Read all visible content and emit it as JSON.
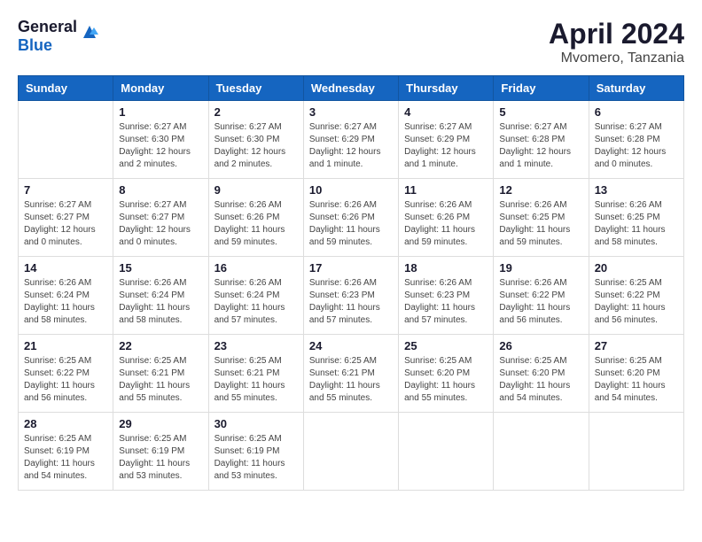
{
  "header": {
    "logo_general": "General",
    "logo_blue": "Blue",
    "month_year": "April 2024",
    "location": "Mvomero, Tanzania"
  },
  "columns": [
    "Sunday",
    "Monday",
    "Tuesday",
    "Wednesday",
    "Thursday",
    "Friday",
    "Saturday"
  ],
  "weeks": [
    [
      {
        "day": "",
        "sunrise": "",
        "sunset": "",
        "daylight": ""
      },
      {
        "day": "1",
        "sunrise": "Sunrise: 6:27 AM",
        "sunset": "Sunset: 6:30 PM",
        "daylight": "Daylight: 12 hours and 2 minutes."
      },
      {
        "day": "2",
        "sunrise": "Sunrise: 6:27 AM",
        "sunset": "Sunset: 6:30 PM",
        "daylight": "Daylight: 12 hours and 2 minutes."
      },
      {
        "day": "3",
        "sunrise": "Sunrise: 6:27 AM",
        "sunset": "Sunset: 6:29 PM",
        "daylight": "Daylight: 12 hours and 1 minute."
      },
      {
        "day": "4",
        "sunrise": "Sunrise: 6:27 AM",
        "sunset": "Sunset: 6:29 PM",
        "daylight": "Daylight: 12 hours and 1 minute."
      },
      {
        "day": "5",
        "sunrise": "Sunrise: 6:27 AM",
        "sunset": "Sunset: 6:28 PM",
        "daylight": "Daylight: 12 hours and 1 minute."
      },
      {
        "day": "6",
        "sunrise": "Sunrise: 6:27 AM",
        "sunset": "Sunset: 6:28 PM",
        "daylight": "Daylight: 12 hours and 0 minutes."
      }
    ],
    [
      {
        "day": "7",
        "sunrise": "Sunrise: 6:27 AM",
        "sunset": "Sunset: 6:27 PM",
        "daylight": "Daylight: 12 hours and 0 minutes."
      },
      {
        "day": "8",
        "sunrise": "Sunrise: 6:27 AM",
        "sunset": "Sunset: 6:27 PM",
        "daylight": "Daylight: 12 hours and 0 minutes."
      },
      {
        "day": "9",
        "sunrise": "Sunrise: 6:26 AM",
        "sunset": "Sunset: 6:26 PM",
        "daylight": "Daylight: 11 hours and 59 minutes."
      },
      {
        "day": "10",
        "sunrise": "Sunrise: 6:26 AM",
        "sunset": "Sunset: 6:26 PM",
        "daylight": "Daylight: 11 hours and 59 minutes."
      },
      {
        "day": "11",
        "sunrise": "Sunrise: 6:26 AM",
        "sunset": "Sunset: 6:26 PM",
        "daylight": "Daylight: 11 hours and 59 minutes."
      },
      {
        "day": "12",
        "sunrise": "Sunrise: 6:26 AM",
        "sunset": "Sunset: 6:25 PM",
        "daylight": "Daylight: 11 hours and 59 minutes."
      },
      {
        "day": "13",
        "sunrise": "Sunrise: 6:26 AM",
        "sunset": "Sunset: 6:25 PM",
        "daylight": "Daylight: 11 hours and 58 minutes."
      }
    ],
    [
      {
        "day": "14",
        "sunrise": "Sunrise: 6:26 AM",
        "sunset": "Sunset: 6:24 PM",
        "daylight": "Daylight: 11 hours and 58 minutes."
      },
      {
        "day": "15",
        "sunrise": "Sunrise: 6:26 AM",
        "sunset": "Sunset: 6:24 PM",
        "daylight": "Daylight: 11 hours and 58 minutes."
      },
      {
        "day": "16",
        "sunrise": "Sunrise: 6:26 AM",
        "sunset": "Sunset: 6:24 PM",
        "daylight": "Daylight: 11 hours and 57 minutes."
      },
      {
        "day": "17",
        "sunrise": "Sunrise: 6:26 AM",
        "sunset": "Sunset: 6:23 PM",
        "daylight": "Daylight: 11 hours and 57 minutes."
      },
      {
        "day": "18",
        "sunrise": "Sunrise: 6:26 AM",
        "sunset": "Sunset: 6:23 PM",
        "daylight": "Daylight: 11 hours and 57 minutes."
      },
      {
        "day": "19",
        "sunrise": "Sunrise: 6:26 AM",
        "sunset": "Sunset: 6:22 PM",
        "daylight": "Daylight: 11 hours and 56 minutes."
      },
      {
        "day": "20",
        "sunrise": "Sunrise: 6:25 AM",
        "sunset": "Sunset: 6:22 PM",
        "daylight": "Daylight: 11 hours and 56 minutes."
      }
    ],
    [
      {
        "day": "21",
        "sunrise": "Sunrise: 6:25 AM",
        "sunset": "Sunset: 6:22 PM",
        "daylight": "Daylight: 11 hours and 56 minutes."
      },
      {
        "day": "22",
        "sunrise": "Sunrise: 6:25 AM",
        "sunset": "Sunset: 6:21 PM",
        "daylight": "Daylight: 11 hours and 55 minutes."
      },
      {
        "day": "23",
        "sunrise": "Sunrise: 6:25 AM",
        "sunset": "Sunset: 6:21 PM",
        "daylight": "Daylight: 11 hours and 55 minutes."
      },
      {
        "day": "24",
        "sunrise": "Sunrise: 6:25 AM",
        "sunset": "Sunset: 6:21 PM",
        "daylight": "Daylight: 11 hours and 55 minutes."
      },
      {
        "day": "25",
        "sunrise": "Sunrise: 6:25 AM",
        "sunset": "Sunset: 6:20 PM",
        "daylight": "Daylight: 11 hours and 55 minutes."
      },
      {
        "day": "26",
        "sunrise": "Sunrise: 6:25 AM",
        "sunset": "Sunset: 6:20 PM",
        "daylight": "Daylight: 11 hours and 54 minutes."
      },
      {
        "day": "27",
        "sunrise": "Sunrise: 6:25 AM",
        "sunset": "Sunset: 6:20 PM",
        "daylight": "Daylight: 11 hours and 54 minutes."
      }
    ],
    [
      {
        "day": "28",
        "sunrise": "Sunrise: 6:25 AM",
        "sunset": "Sunset: 6:19 PM",
        "daylight": "Daylight: 11 hours and 54 minutes."
      },
      {
        "day": "29",
        "sunrise": "Sunrise: 6:25 AM",
        "sunset": "Sunset: 6:19 PM",
        "daylight": "Daylight: 11 hours and 53 minutes."
      },
      {
        "day": "30",
        "sunrise": "Sunrise: 6:25 AM",
        "sunset": "Sunset: 6:19 PM",
        "daylight": "Daylight: 11 hours and 53 minutes."
      },
      {
        "day": "",
        "sunrise": "",
        "sunset": "",
        "daylight": ""
      },
      {
        "day": "",
        "sunrise": "",
        "sunset": "",
        "daylight": ""
      },
      {
        "day": "",
        "sunrise": "",
        "sunset": "",
        "daylight": ""
      },
      {
        "day": "",
        "sunrise": "",
        "sunset": "",
        "daylight": ""
      }
    ]
  ]
}
